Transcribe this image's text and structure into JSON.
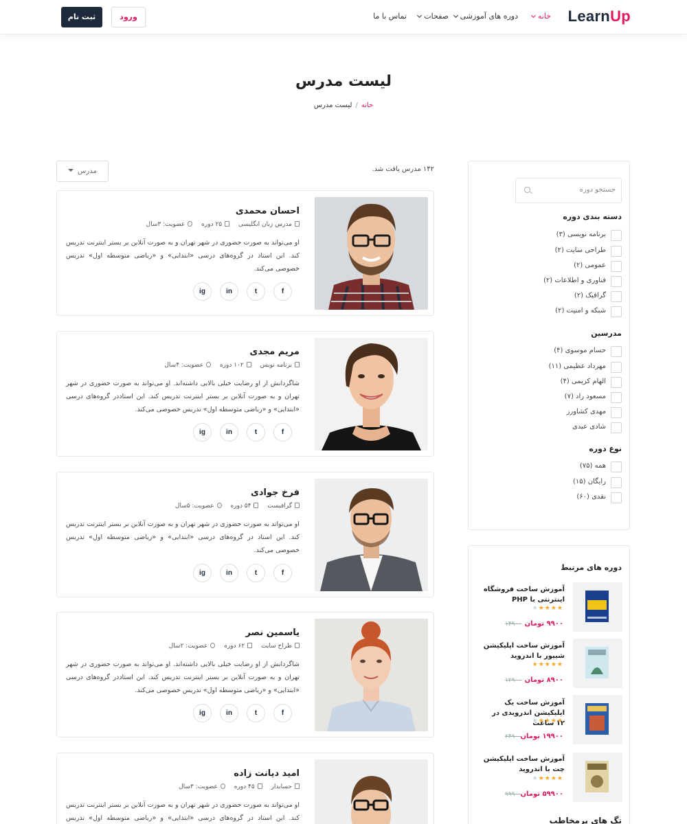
{
  "brand": {
    "logo_part1": "Learn",
    "logo_part2": "Up"
  },
  "nav": {
    "home": "خانه",
    "courses": "دوره های آموزشی",
    "pages": "صفحات",
    "contact": "تماس با ما",
    "login": "ورود",
    "register": "ثبت نام"
  },
  "page": {
    "title": "لیست مدرس",
    "breadcrumb": {
      "home": "خانه",
      "sep": "/",
      "current": "لیست مدرس"
    },
    "results": "۱۴۲ مدرس یافت شد.",
    "sort_label": "مدرس"
  },
  "instructors": [
    {
      "name": "احسان محمدی",
      "role": "مدرس زبان انگلیسی",
      "courses": "۲۵ دوره",
      "membership": "عضویت: ۳سال",
      "bio": "او می‌تواند به صورت حضوری در شهر تهران و به صورت آنلاین بر بستر اینترنت تدریس کند. این استاد در گروه‌های درسی «ابتدایی» و «ریاضی متوسطه اول» تدریس خصوصی می‌کند."
    },
    {
      "name": "مریم مجدی",
      "role": "برنامه نویس",
      "courses": "۱۰۲ دوره",
      "membership": "عضویت: ۴سال",
      "bio": "شاگردانش از او رضایت خیلی بالایی داشته‌اند. او می‌تواند به صورت حضوری در شهر تهران و به صورت آنلاین بر بستر اینترنت تدریس کند. این استاددر گروه‌های درسی «ابتدایی» و «ریاضی متوسطه اول» تدریس خصوصی می‌کند."
    },
    {
      "name": "فرخ جوادی",
      "role": "گرافیست",
      "courses": "۵۴ دوره",
      "membership": "عضویت: ۵سال",
      "bio": "او می‌تواند به صورت حضوری در شهر تهران و به صورت آنلاین بر بستر اینترنت تدریس کند. این استاد در گروه‌های درسی «ابتدایی» و «ریاضی متوسطه اول» تدریس خصوصی می‌کند."
    },
    {
      "name": "یاسمین نصر",
      "role": "طراح سایت",
      "courses": "۶۲ دوره",
      "membership": "عضویت: ۲سال",
      "bio": "شاگردانش از او رضایت خیلی بالایی داشته‌اند. او می‌تواند به صورت حضوری در شهر تهران و به صورت آنلاین بر بستر اینترنت تدریس کند. این استاددر گروه‌های درسی «ابتدایی» و «ریاضی متوسطه اول» تدریس خصوصی می‌کند."
    },
    {
      "name": "امید دیانت زاده",
      "role": "حسابدار",
      "courses": "۴۵ دوره",
      "membership": "عضویت: ۳سال",
      "bio": "او می‌تواند به صورت حضوری در شهر تهران و به صورت آنلاین بر بستر اینترنت تدریس کند. این استاد در گروه‌های درسی «ابتدایی» و «ریاضی متوسطه اول» تدریس خصوصی می‌کند."
    }
  ],
  "social": {
    "facebook": "f",
    "twitter": "t",
    "linkedin": "in",
    "instagram": "ig"
  },
  "sidebar": {
    "search_placeholder": "جستجو دوره",
    "categories_title": "دسته بندی دوره",
    "categories": [
      "برنامه نویسی (۳)",
      "طراحی سایت (۲)",
      "عمومی (۲)",
      "فناوری و اطلاعات (۲)",
      "گرافیک (۲)",
      "شبکه و امنیت (۲)"
    ],
    "instructors_title": "مدرسین",
    "instructors": [
      "حسام موسوی (۴)",
      "مهرداد عظیمی (۱۱)",
      "الهام کریمی (۴)",
      "مسعود راد (۷)",
      "مهدی کشاورز",
      "شادی عبدی"
    ],
    "type_title": "نوع دوره",
    "types": [
      "همه (۷۵)",
      "رایگان (۱۵)",
      "نقدی (۶۰)"
    ],
    "related_title": "دوره های مرتبط",
    "related": [
      {
        "title": "آموزش ساخت فروشگاه اینترنتی با PHP",
        "price": "۹۹۰۰ تومان",
        "old_price": "۱۴۹۰۰",
        "rating": 4,
        "cover_color": "#1b3f8f"
      },
      {
        "title": "آموزش ساخت اپلیکیشن شیپور با اندروید",
        "price": "۸۹۰۰ تومان",
        "old_price": "۱۲۹۰۰",
        "rating": 5,
        "cover_color": "#bfe1e8"
      },
      {
        "title": "آموزش ساخت یک اپلیکیشن اندرویدی در ۱۲ ساعت",
        "price": "۱۹۹۰۰ تومان",
        "old_price": "۲۴۹۰۰",
        "rating": 4,
        "cover_color": "#2d5fa8"
      },
      {
        "title": "آموزش ساخت اپلیکیشن چت با اندروید",
        "price": "۵۹۹۰۰ تومان",
        "old_price": "۹۹۹۰۰",
        "rating": 4,
        "cover_color": "#d8c79a"
      }
    ],
    "tags_title": "تگ های پرمخاطب"
  },
  "colors": {
    "accent": "#e2195d",
    "dark": "#1d2a3b",
    "star": "#f5a623"
  }
}
